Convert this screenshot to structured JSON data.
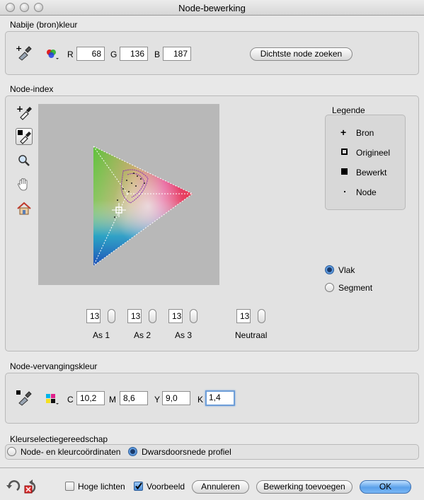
{
  "window": {
    "title": "Node-bewerking"
  },
  "source_color": {
    "label": "Nabije (bron)kleur",
    "r_label": "R",
    "r_value": "68",
    "g_label": "G",
    "g_value": "136",
    "b_label": "B",
    "b_value": "187",
    "find_button": "Dichtste node zoeken"
  },
  "node_index": {
    "label": "Node-index",
    "tools": [
      "add-eyedropper-icon",
      "eyedropper-icon",
      "zoom-icon",
      "hand-icon",
      "home-icon"
    ],
    "axes": [
      {
        "label": "As 1",
        "value": "13"
      },
      {
        "label": "As 2",
        "value": "13"
      },
      {
        "label": "As 3",
        "value": "13"
      },
      {
        "label": "Neutraal",
        "value": "13"
      }
    ],
    "legend": {
      "title": "Legende",
      "items": [
        "Bron",
        "Origineel",
        "Bewerkt",
        "Node"
      ]
    },
    "view_options": [
      {
        "label": "Vlak",
        "selected": true
      },
      {
        "label": "Segment",
        "selected": false
      }
    ]
  },
  "replacement_color": {
    "label": "Node-vervangingskleur",
    "c_label": "C",
    "c_value": "10,2",
    "m_label": "M",
    "m_value": "8,6",
    "y_label": "Y",
    "y_value": "9,0",
    "k_label": "K",
    "k_value": "1,4"
  },
  "selection_tool": {
    "label": "Kleurselectiegereedschap",
    "options": [
      {
        "label": "Node- en kleurcoördinaten",
        "selected": false
      },
      {
        "label": "Dwarsdoorsnede profiel",
        "selected": true
      }
    ]
  },
  "footer": {
    "highlights_label": "Hoge lichten",
    "highlights_checked": false,
    "preview_label": "Voorbeeld",
    "preview_checked": true,
    "cancel_button": "Annuleren",
    "add_edit_button": "Bewerking toevoegen",
    "ok_button": "OK"
  }
}
